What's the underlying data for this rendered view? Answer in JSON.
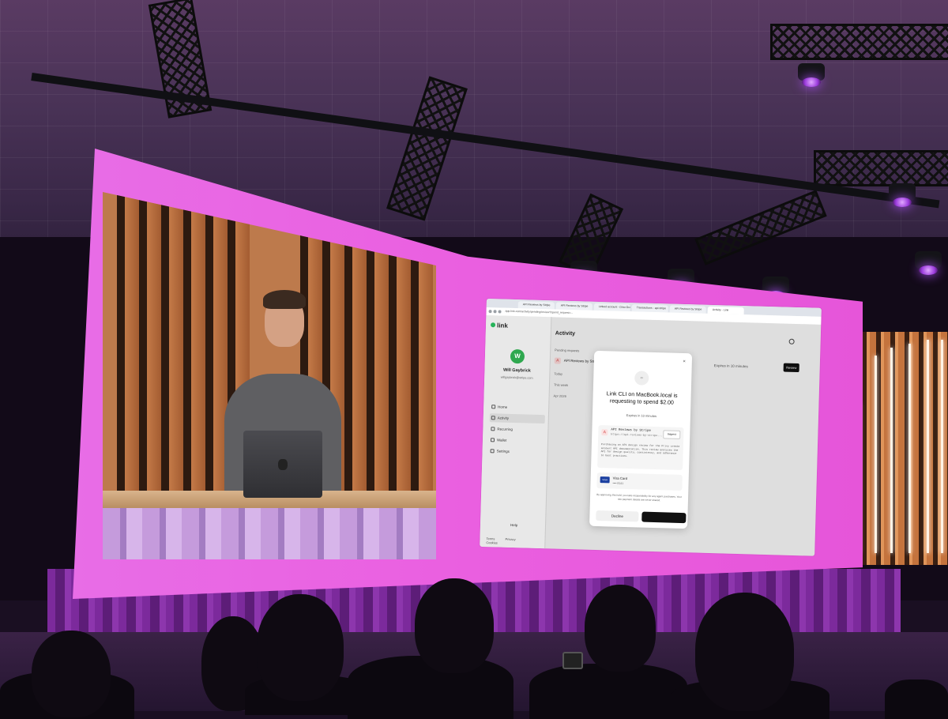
{
  "browser": {
    "tabs": [
      "API Reviews by Stripe",
      "API Reviews by Stripe",
      "Linked account - Dino Gran",
      "Transactions - api.stripe",
      "API Reviews by Stripe",
      "Activity - Link"
    ],
    "url": "app.link.com/activity/pending/review?spend_request=..."
  },
  "app": {
    "logo": "link",
    "user": {
      "initial": "W",
      "name": "Will Gaybrick",
      "email": "willgaybrick@stripe.com"
    },
    "nav": [
      "Home",
      "Activity",
      "Recurring",
      "Wallet",
      "Settings"
    ],
    "help": "Help",
    "footer": [
      "Terms",
      "Privacy",
      "Cookies"
    ],
    "page_title": "Activity",
    "sections": {
      "pending": "Pending requests",
      "today": "Today",
      "this_week": "This week",
      "month": "Apr 2026"
    },
    "pending_item": {
      "icon": "A",
      "label": "API Reviews by Stri",
      "expires": "Expires in 10 minutes",
      "review_label": "Review"
    }
  },
  "modal": {
    "close": "×",
    "badge": "‹›",
    "title": "Link CLI on MacBook.local is requesting to spend $2.00",
    "expires": "Expires in 10 minutes",
    "merchant": {
      "icon": "A",
      "name": "API Reviews by Stripe",
      "url": "https://api-reviews-by-stripe...",
      "inspect": "Inspect",
      "description": "Purchasing an API design review for the Privy create account API documentation. This review analyzes the API for design quality, consistency, and adherence to best practices."
    },
    "card": {
      "brand": "VISA",
      "name": "Visa Card",
      "number": "•••• 8141"
    },
    "disclaimer": "By approving this hold, you take responsibility for any agent purchases. Your raw payment details are never shared.",
    "decline": "Decline",
    "approve": ""
  },
  "colors": {
    "screen_pink": "#e86de6",
    "link_green": "#26b35a",
    "stage_purple": "#7c2a9c"
  }
}
